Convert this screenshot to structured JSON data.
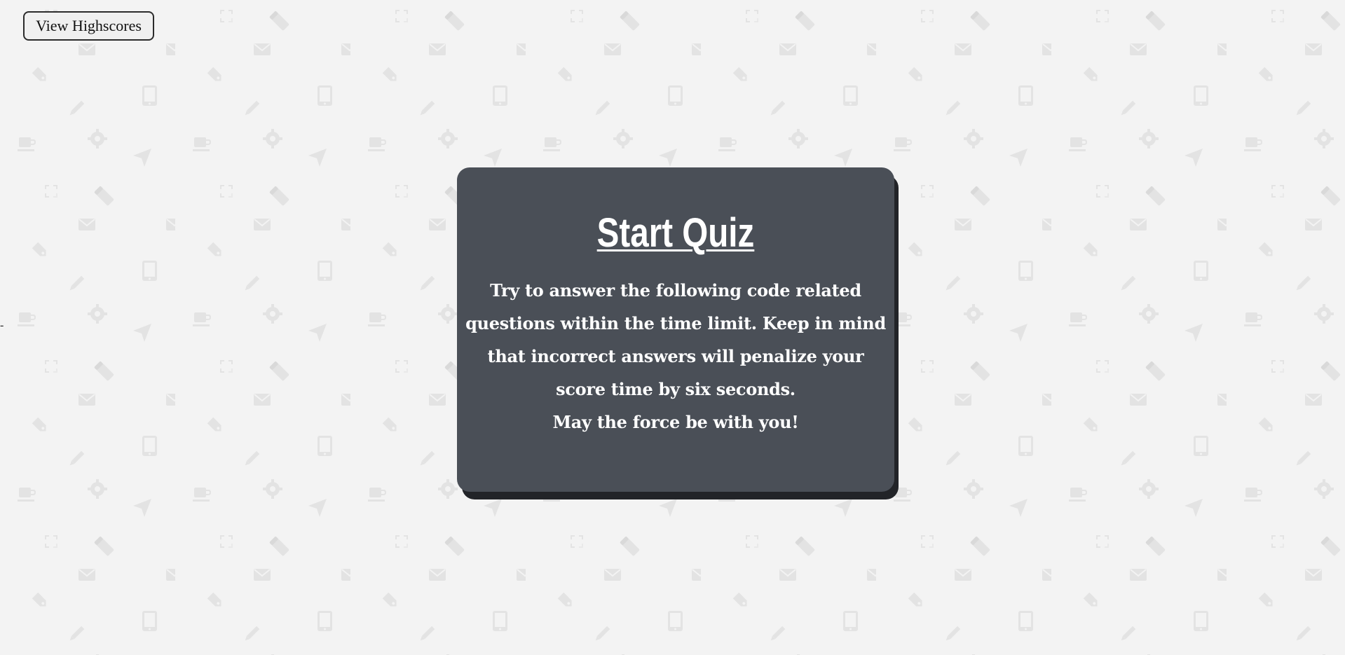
{
  "header": {
    "highscores_label": "View Highscores"
  },
  "timer": {
    "display": "-"
  },
  "quiz": {
    "title": "Start Quiz",
    "description": "Try to answer the following code related questions within the time limit. Keep in mind that incorrect answers will penalize your score time by six seconds.",
    "farewell": "May the force be with you!"
  },
  "colors": {
    "page_background": "#f3f3f3",
    "pattern_icon": "#e3e3e3",
    "card_background": "#4a4f57",
    "card_shadow": "#222428",
    "card_text": "#ffffff"
  },
  "background_pattern_icons": [
    "expand-icon",
    "eraser-icon",
    "envelope-icon",
    "tag-icon",
    "tablet-icon",
    "pencil-icon",
    "coffee-cup-icon",
    "gear-icon",
    "paper-plane-icon"
  ]
}
